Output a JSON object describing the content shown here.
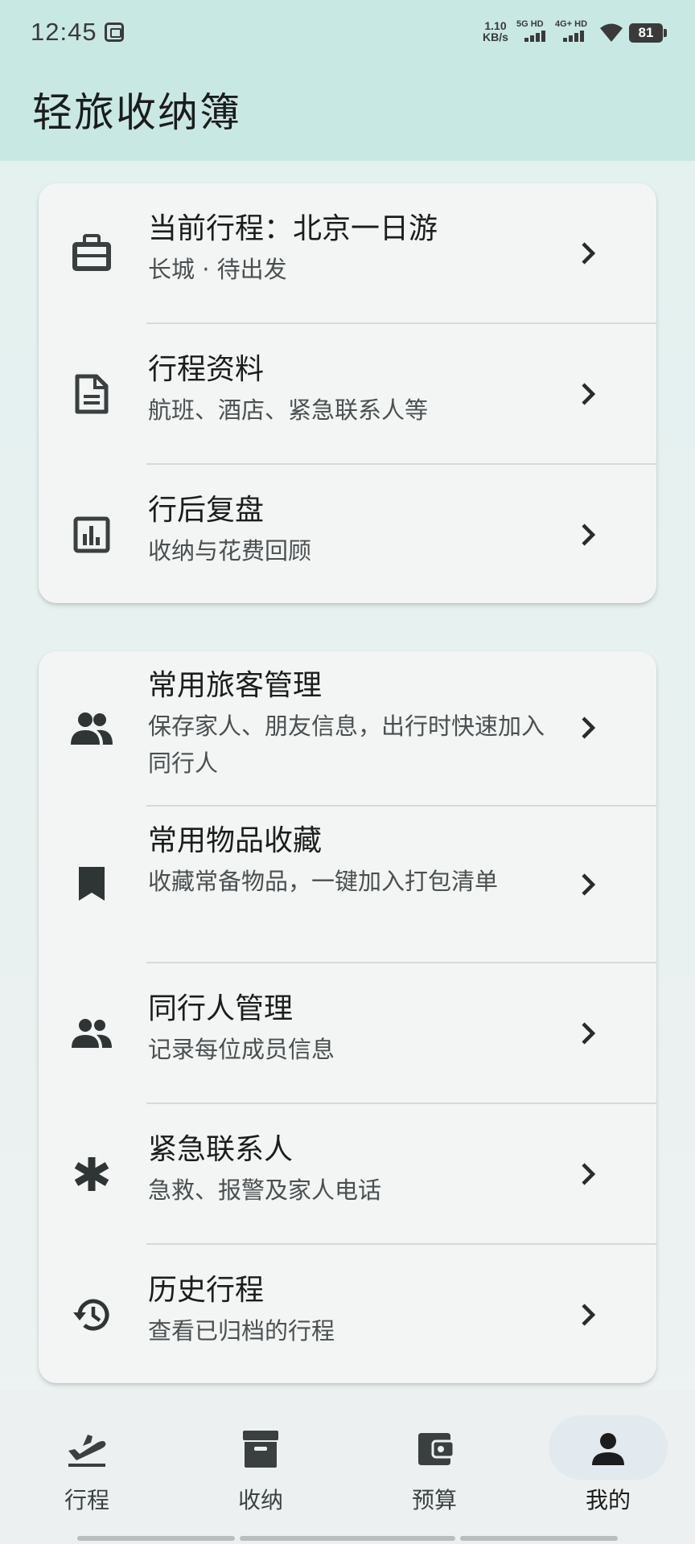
{
  "status_bar": {
    "time": "12:45",
    "net_speed_value": "1.10",
    "net_speed_unit": "KB/s",
    "signal1_label": "5G HD",
    "signal2_label": "4G+ HD",
    "battery": "81",
    "icons": [
      "sim-icon",
      "signal-icon",
      "wifi-icon",
      "battery-icon"
    ]
  },
  "header": {
    "title": "轻旅收纳簿"
  },
  "card1": {
    "items": [
      {
        "icon": "briefcase-icon",
        "title": "当前行程：北京一日游",
        "subtitle": "长城 · 待出发"
      },
      {
        "icon": "document-icon",
        "title": "行程资料",
        "subtitle": "航班、酒店、紧急联系人等"
      },
      {
        "icon": "bar-chart-icon",
        "title": "行后复盘",
        "subtitle": "收纳与花费回顾"
      }
    ]
  },
  "card2": {
    "items": [
      {
        "icon": "people-icon",
        "title": "常用旅客管理",
        "subtitle": "保存家人、朋友信息，出行时快速加入同行人"
      },
      {
        "icon": "bookmark-icon",
        "title": "常用物品收藏",
        "subtitle": "收藏常备物品，一键加入打包清单"
      },
      {
        "icon": "group-icon",
        "title": "同行人管理",
        "subtitle": "记录每位成员信息"
      },
      {
        "icon": "asterisk-icon",
        "title": "紧急联系人",
        "subtitle": "急救、报警及家人电话"
      },
      {
        "icon": "history-icon",
        "title": "历史行程",
        "subtitle": "查看已归档的行程"
      }
    ]
  },
  "bottom_nav": {
    "items": [
      {
        "icon": "flight-takeoff-icon",
        "label": "行程"
      },
      {
        "icon": "archive-box-icon",
        "label": "收纳"
      },
      {
        "icon": "wallet-icon",
        "label": "预算"
      },
      {
        "icon": "person-icon",
        "label": "我的"
      }
    ],
    "active_index": 3
  },
  "colors": {
    "header_bg": "#c8e8e3",
    "card_bg": "#f3f5f5",
    "text_primary": "#1c1c1c",
    "text_secondary": "#4a4f4f",
    "nav_active_pill": "#e2eaf0"
  }
}
